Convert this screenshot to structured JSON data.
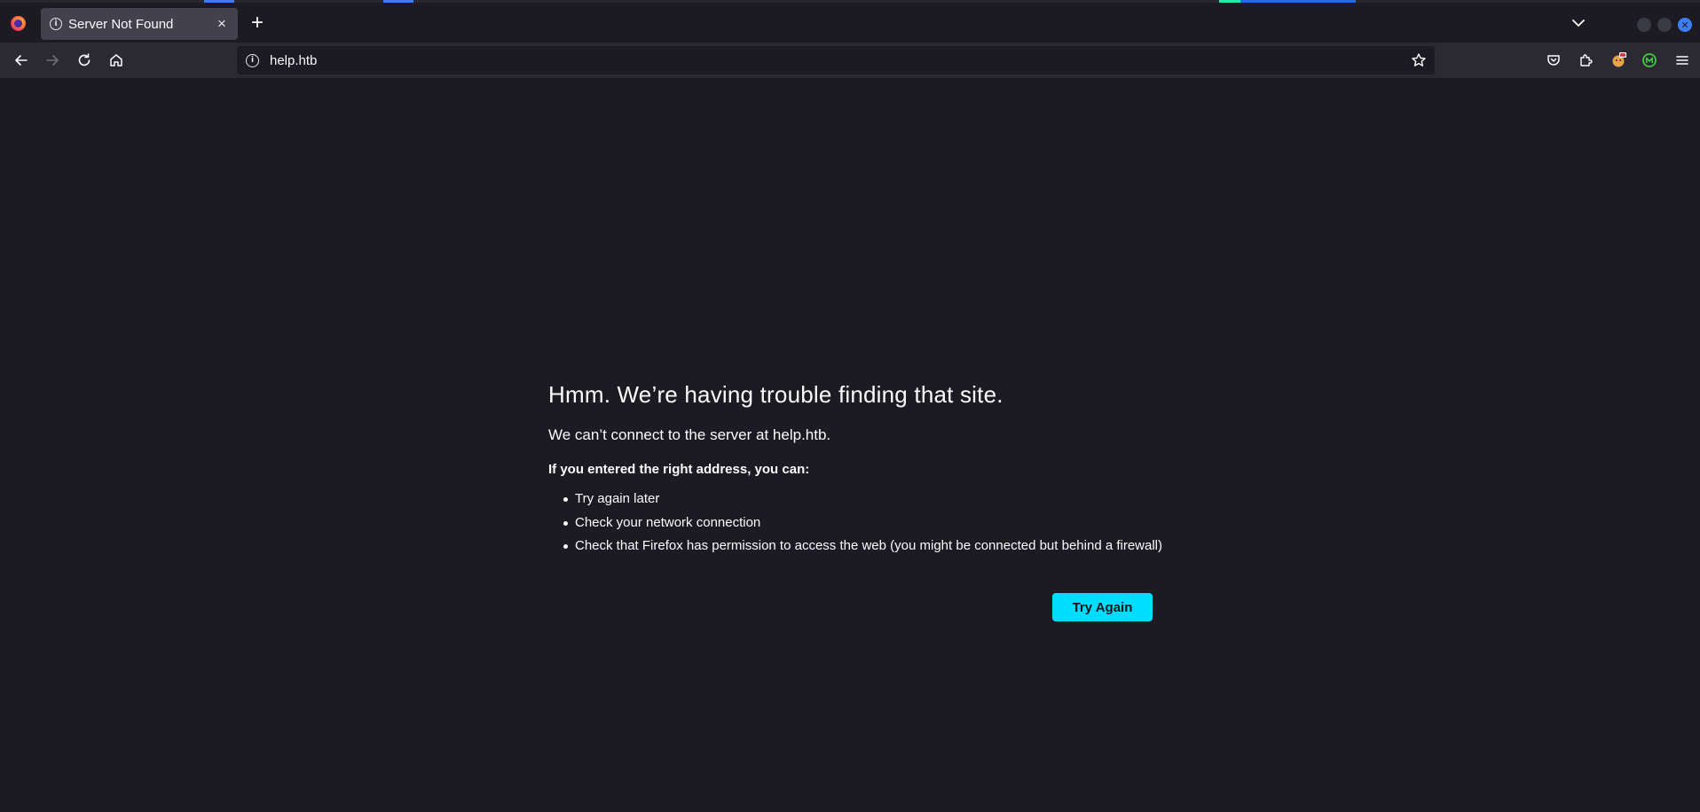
{
  "browser": {
    "tab": {
      "title": "Server Not Found",
      "close_glyph": "×"
    },
    "new_tab_glyph": "+",
    "url": "help.htb",
    "colors": {
      "accent": "#00ddff",
      "background": "#1c1b22",
      "toolbar": "#2b2a33"
    }
  },
  "icons": [
    "firefox-logo-icon",
    "info-icon",
    "close-icon",
    "plus-icon",
    "chevron-down-icon",
    "back-arrow-icon",
    "forward-arrow-icon",
    "reload-icon",
    "home-icon",
    "bookmark-star-icon",
    "pocket-icon",
    "extensions-icon",
    "menu-icon"
  ],
  "error_page": {
    "title": "Hmm. We’re having trouble finding that site.",
    "description": "We can’t connect to the server at help.htb.",
    "lead": "If you entered the right address, you can:",
    "suggestions": [
      "Try again later",
      "Check your network connection",
      "Check that Firefox has permission to access the web (you might be connected but behind a firewall)"
    ],
    "button_label": "Try Again"
  }
}
